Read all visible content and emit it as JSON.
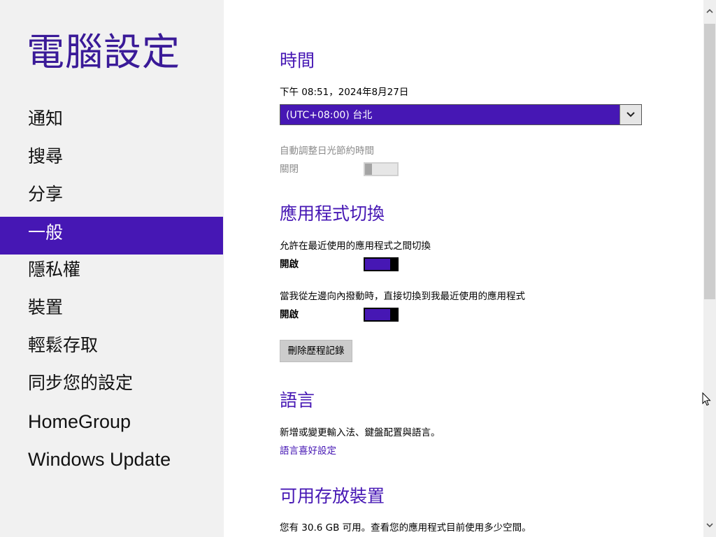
{
  "app": {
    "title": "電腦設定",
    "nav": [
      {
        "label": "通知"
      },
      {
        "label": "搜尋"
      },
      {
        "label": "分享"
      },
      {
        "label": "一般",
        "selected": true
      },
      {
        "label": "隱私權"
      },
      {
        "label": "裝置"
      },
      {
        "label": "輕鬆存取"
      },
      {
        "label": "同步您的設定"
      },
      {
        "label": "HomeGroup"
      },
      {
        "label": "Windows Update"
      }
    ]
  },
  "time": {
    "title": "時間",
    "current": "下午 08:51，2024年8月27日",
    "timezone": "(UTC+08:00) 台北",
    "dst_label": "自動調整日光節約時間",
    "dst_state": "關閉"
  },
  "app_switching": {
    "title": "應用程式切換",
    "allow_label": "允許在最近使用的應用程式之間切換",
    "allow_state": "開啟",
    "swipe_label": "當我從左邊向內撥動時，直接切換到我最近使用的應用程式",
    "swipe_state": "開啟",
    "clear_history": "刪除歷程記錄"
  },
  "language": {
    "title": "語言",
    "description": "新增或變更輸入法、鍵盤配置與語言。",
    "link": "語言喜好設定"
  },
  "storage": {
    "title": "可用存放裝置",
    "description": "您有 30.6 GB 可用。查看您的應用程式目前使用多少空間。"
  },
  "colors": {
    "accent": "#4617b4",
    "title": "#3a1a98",
    "left_pane_bg": "#f1f1f1"
  }
}
